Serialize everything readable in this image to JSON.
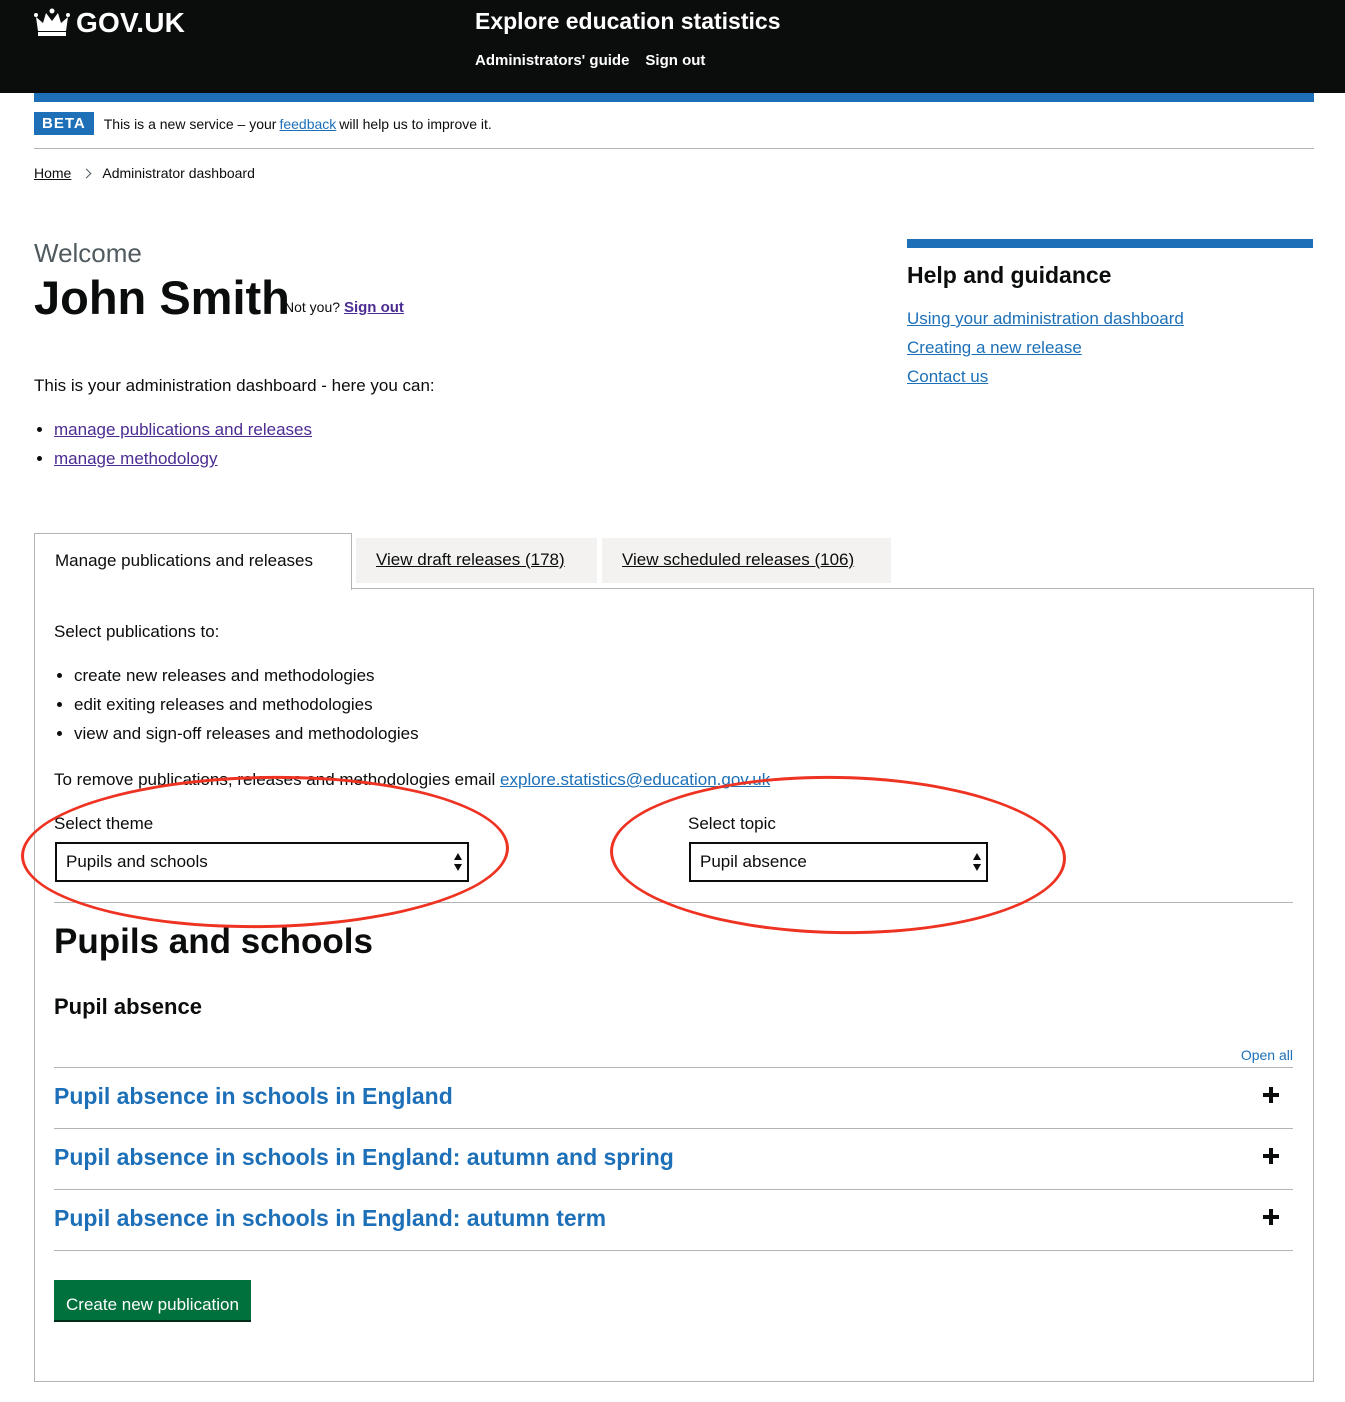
{
  "header": {
    "logo_text": "GOV.UK",
    "service_name": "Explore education statistics",
    "nav": [
      "Administrators' guide",
      "Sign out"
    ]
  },
  "phase": {
    "tag": "BETA",
    "text_before": "This is a new service – your ",
    "link": "feedback",
    "text_after": " will help us to improve it."
  },
  "breadcrumb": {
    "home": "Home",
    "current": "Administrator dashboard"
  },
  "welcome": {
    "caption": "Welcome",
    "name": "John Smith",
    "not_you": "Not you?",
    "sign_out": "Sign out"
  },
  "intro": {
    "text": "This is your administration dashboard - here you can:",
    "links": [
      "manage publications and releases",
      "manage methodology"
    ]
  },
  "help": {
    "title": "Help and guidance",
    "links": [
      "Using your administration dashboard",
      "Creating a new release",
      "Contact us"
    ]
  },
  "tabs": [
    {
      "label": "Manage publications and releases"
    },
    {
      "label": "View draft releases (178)"
    },
    {
      "label": "View scheduled releases (106)"
    }
  ],
  "panel": {
    "select_text": "Select publications to:",
    "bullets": [
      "create new releases and methodologies",
      "edit exiting releases and methodologies",
      "view and sign-off releases and methodologies"
    ],
    "remove_text": "To remove publications, releases and methodologies email ",
    "email": "explore.statistics@education.gov.uk",
    "theme_label": "Select theme",
    "theme_value": "Pupils and schools",
    "topic_label": "Select topic",
    "topic_value": "Pupil absence",
    "theme_heading": "Pupils and schools",
    "topic_heading": "Pupil absence",
    "open_all": "Open all",
    "publications": [
      "Pupil absence in schools in England",
      "Pupil absence in schools in England: autumn and spring",
      "Pupil absence in schools in England: autumn term"
    ],
    "create_button": "Create new publication"
  },
  "colors": {
    "link": "#1d70b8",
    "visited": "#4c2c92",
    "button": "#00703c",
    "annotation": "#ee3322",
    "header_bg": "#0b0c0c"
  },
  "icons": [
    "crown-icon",
    "chevron-right-icon",
    "select-arrows-icon",
    "plus-icon"
  ]
}
